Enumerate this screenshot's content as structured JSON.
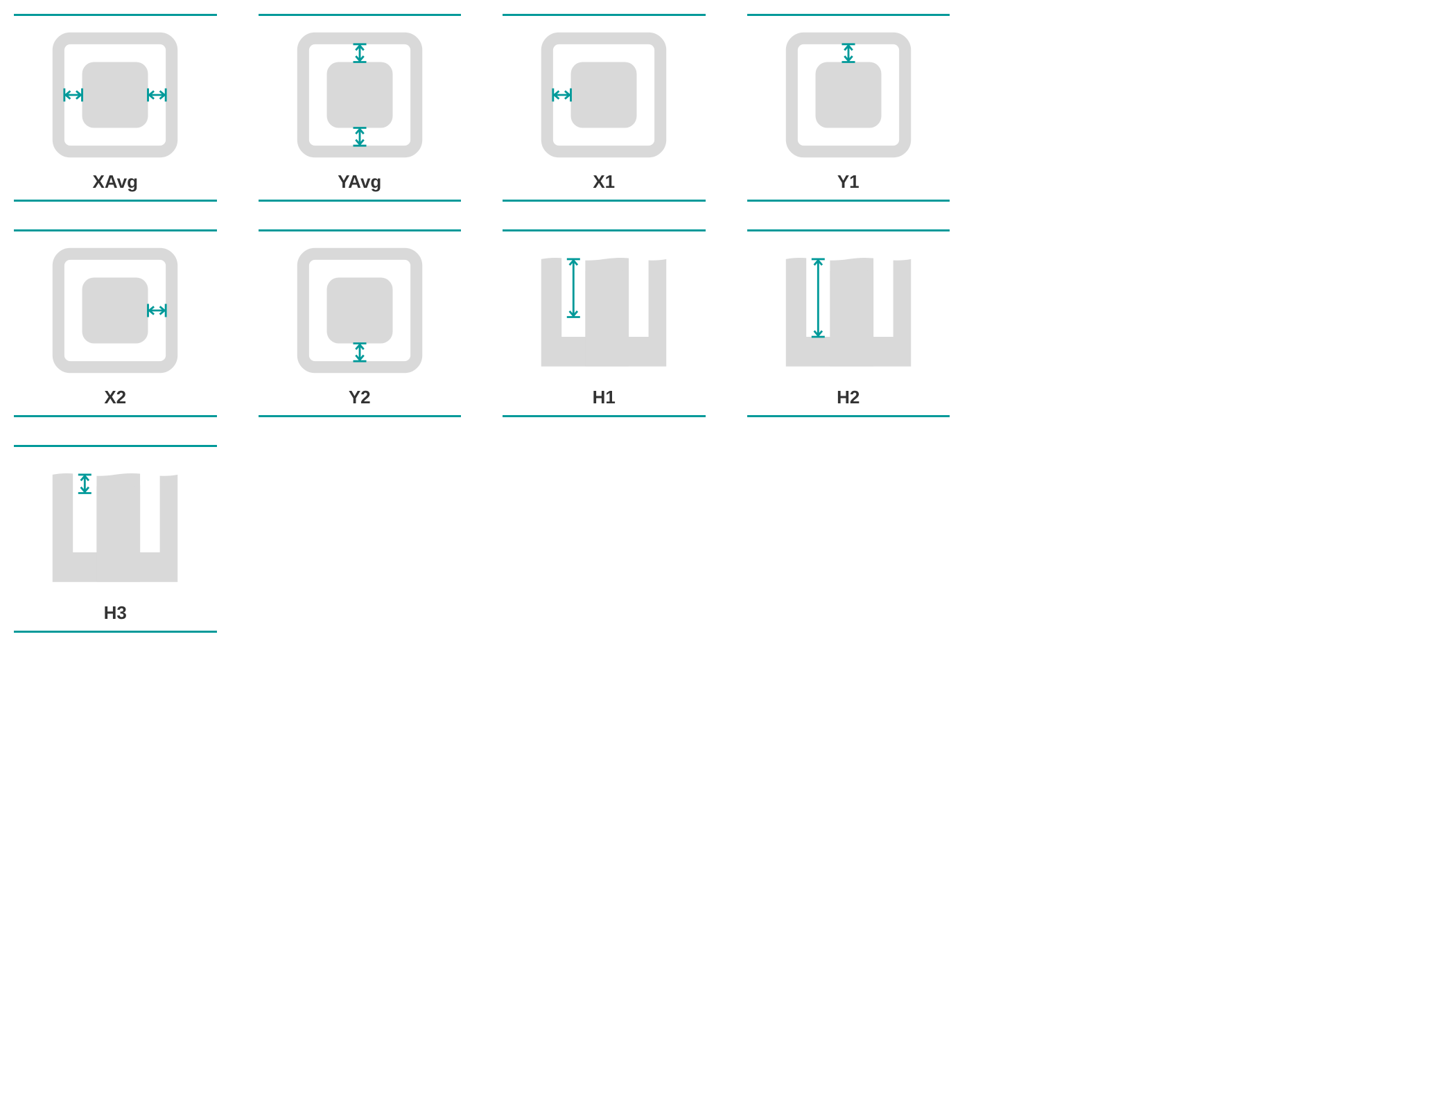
{
  "accent": "#009999",
  "shape_fill": "#d9d9d9",
  "label_color": "#333333",
  "cells": [
    {
      "id": "xavg",
      "label": "XAvg",
      "kind": "box",
      "arrows": [
        "left",
        "right"
      ]
    },
    {
      "id": "yavg",
      "label": "YAvg",
      "kind": "box",
      "arrows": [
        "top",
        "bottom"
      ]
    },
    {
      "id": "x1",
      "label": "X1",
      "kind": "box",
      "arrows": [
        "left"
      ]
    },
    {
      "id": "y1",
      "label": "Y1",
      "kind": "box",
      "arrows": [
        "top"
      ]
    },
    {
      "id": "x2",
      "label": "X2",
      "kind": "box",
      "arrows": [
        "right"
      ]
    },
    {
      "id": "y2",
      "label": "Y2",
      "kind": "box",
      "arrows": [
        "bottom"
      ]
    },
    {
      "id": "h1",
      "label": "H1",
      "kind": "profile",
      "depth": "mid"
    },
    {
      "id": "h2",
      "label": "H2",
      "kind": "profile",
      "depth": "tall"
    },
    {
      "id": "h3",
      "label": "H3",
      "kind": "profile",
      "depth": "short"
    }
  ]
}
